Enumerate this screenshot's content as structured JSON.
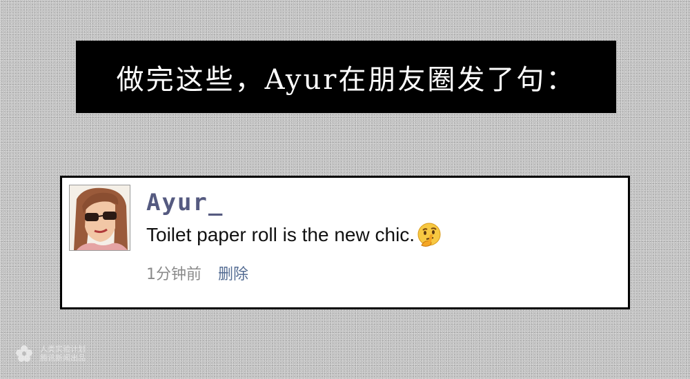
{
  "caption": {
    "text": "做完这些，Ayur在朋友圈发了句："
  },
  "post": {
    "avatar_icon": "woman-with-sunglasses-avatar",
    "username": "Ayur_",
    "text": "Toilet paper roll is the new chic.",
    "emoji_icon": "thinking-face-emoji",
    "time": "1分钟前",
    "delete_label": "删除"
  },
  "colors": {
    "username": "#555a80",
    "delete_link": "#546c93",
    "caption_bg": "#000000",
    "page_bg": "#c9c9c9"
  },
  "watermark": {
    "line1": "人类实验计划",
    "line2": "腾讯新闻出品"
  }
}
